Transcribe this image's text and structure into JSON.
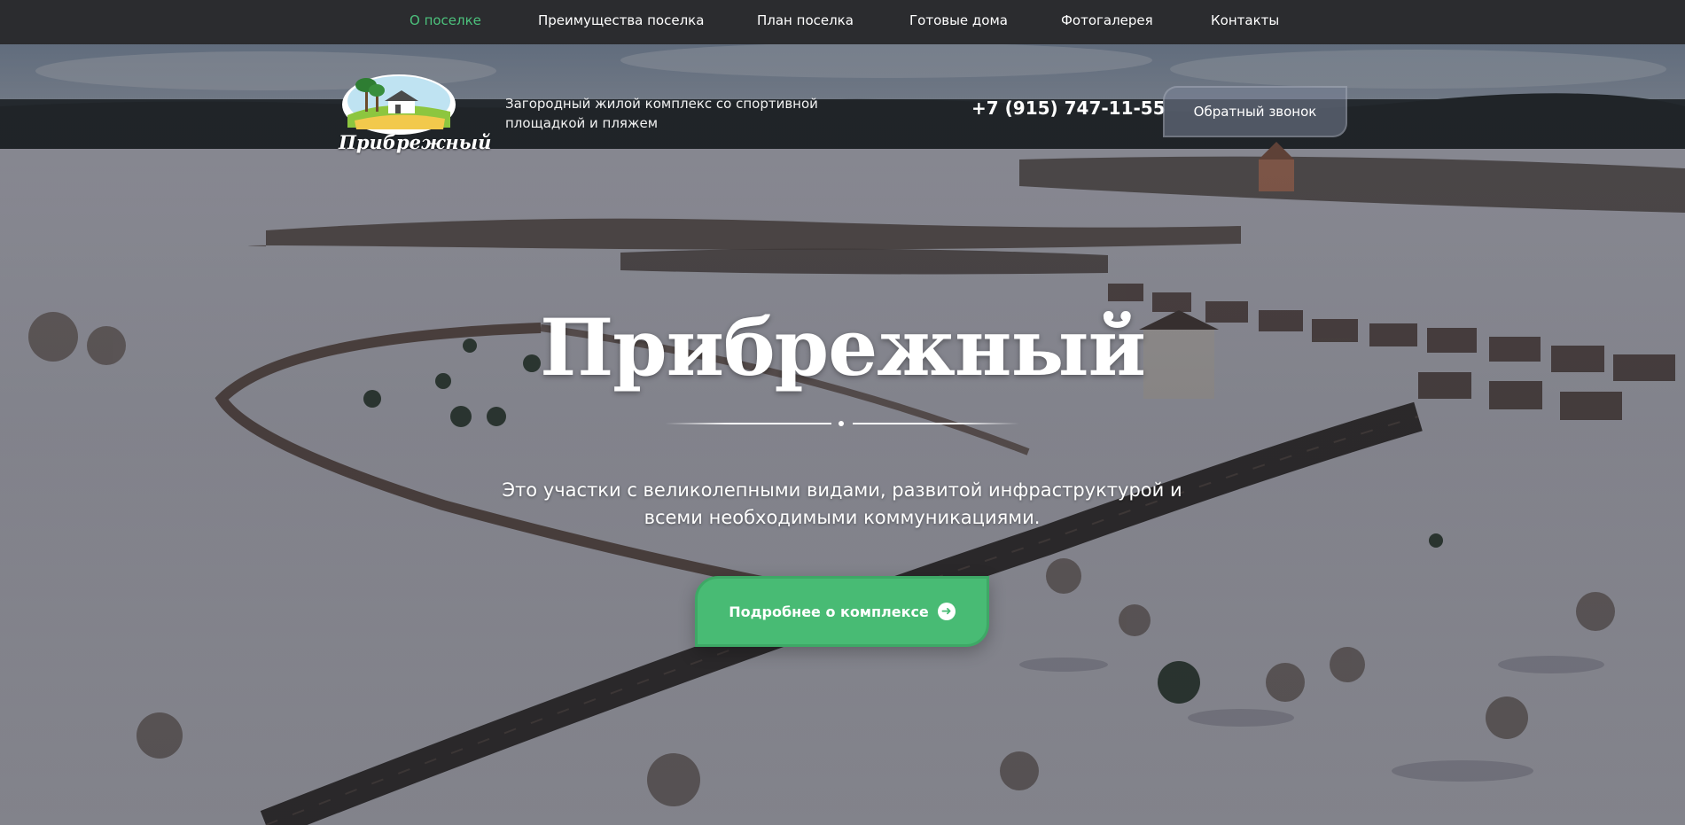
{
  "nav": {
    "items": [
      {
        "label": "О поселке",
        "active": true
      },
      {
        "label": "Преимущества поселка",
        "active": false
      },
      {
        "label": "План поселка",
        "active": false
      },
      {
        "label": "Готовые дома",
        "active": false
      },
      {
        "label": "Фотогалерея",
        "active": false
      },
      {
        "label": "Контакты",
        "active": false
      }
    ],
    "active_color": "#4cc17c"
  },
  "header": {
    "logo_text": "Прибрежный",
    "tagline": "Загородный жилой комплекс со спортивной площадкой и пляжем",
    "phone": "+7 (915) 747-11-55",
    "callback_label": "Обратный звонок"
  },
  "hero": {
    "title": "Прибрежный",
    "subtitle": "Это участки с великолепными видами, развитой инфраструктурой и всеми необходимыми коммуникациями.",
    "cta_label": "Подробнее о комплексе",
    "cta_icon": "arrow-circle-right-icon",
    "cta_color": "#48bb74"
  }
}
